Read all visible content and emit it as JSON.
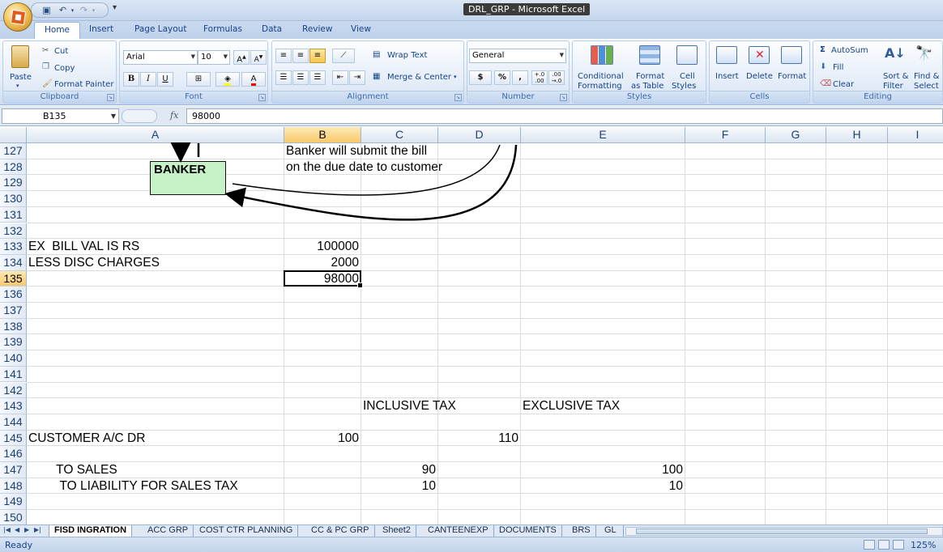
{
  "window": {
    "title": "DRL_GRP - Microsoft Excel"
  },
  "ribbon": {
    "tabs": [
      "Home",
      "Insert",
      "Page Layout",
      "Formulas",
      "Data",
      "Review",
      "View"
    ],
    "active_tab": "Home",
    "clipboard": {
      "label": "Clipboard",
      "paste": "Paste",
      "cut": "Cut",
      "copy": "Copy",
      "format_painter": "Format Painter"
    },
    "font": {
      "label": "Font",
      "name": "Arial",
      "size": "10",
      "bold": "B",
      "italic": "I",
      "underline": "U"
    },
    "alignment": {
      "label": "Alignment",
      "wrap_text": "Wrap Text",
      "merge_center": "Merge & Center"
    },
    "number": {
      "label": "Number",
      "format": "General",
      "currency": "$",
      "percent": "%",
      "comma": ",",
      "inc_decimal": "+.0 .00",
      "dec_decimal": ".00 →.0"
    },
    "styles": {
      "label": "Styles",
      "conditional_1": "Conditional",
      "conditional_2": "Formatting",
      "format_table_1": "Format",
      "format_table_2": "as Table",
      "cell_styles_1": "Cell",
      "cell_styles_2": "Styles"
    },
    "cells": {
      "label": "Cells",
      "insert": "Insert",
      "delete": "Delete",
      "format": "Format"
    },
    "editing": {
      "label": "Editing",
      "autosum": "AutoSum",
      "fill": "Fill",
      "clear": "Clear",
      "sort_1": "Sort &",
      "sort_2": "Filter",
      "find_1": "Find &",
      "find_2": "Select"
    }
  },
  "formula_bar": {
    "name_box": "B135",
    "fx": "fx",
    "formula": "98000"
  },
  "grid": {
    "columns": [
      "A",
      "B",
      "C",
      "D",
      "E",
      "F",
      "G",
      "H",
      "I"
    ],
    "selected_column": "B",
    "rows": [
      "127",
      "128",
      "129",
      "130",
      "131",
      "132",
      "133",
      "134",
      "135",
      "136",
      "137",
      "138",
      "139",
      "140",
      "141",
      "142",
      "143",
      "144",
      "145",
      "146",
      "147",
      "148",
      "149",
      "150"
    ],
    "selected_row": "135",
    "cells": {
      "B127": "Banker will submit the bill",
      "B128": "on the due date to customer",
      "A133": "EX  BILL VAL IS RS",
      "B133": "100000",
      "A134": "LESS DISC CHARGES",
      "B134": "2000",
      "B135": "98000",
      "C143": "INCLUSIVE TAX",
      "E143": "EXCLUSIVE TAX",
      "A145": "CUSTOMER A/C DR",
      "B145": "100",
      "D145": "110",
      "A147": "        TO SALES",
      "C147": "90",
      "E147": "100",
      "A148": "         TO LIABILITY FOR SALES TAX",
      "C148": "10",
      "E148": "10"
    },
    "banker_box": "BANKER"
  },
  "sheet_tabs": [
    "FISD INGRATION",
    "ACC GRP",
    "COST CTR PLANNING",
    "CC & PC GRP",
    "Sheet2",
    "CANTEENEXP",
    "DOCUMENTS",
    "BRS",
    "GL"
  ],
  "active_sheet": "FISD INGRATION",
  "status": {
    "text": "Ready",
    "zoom": "125%"
  }
}
